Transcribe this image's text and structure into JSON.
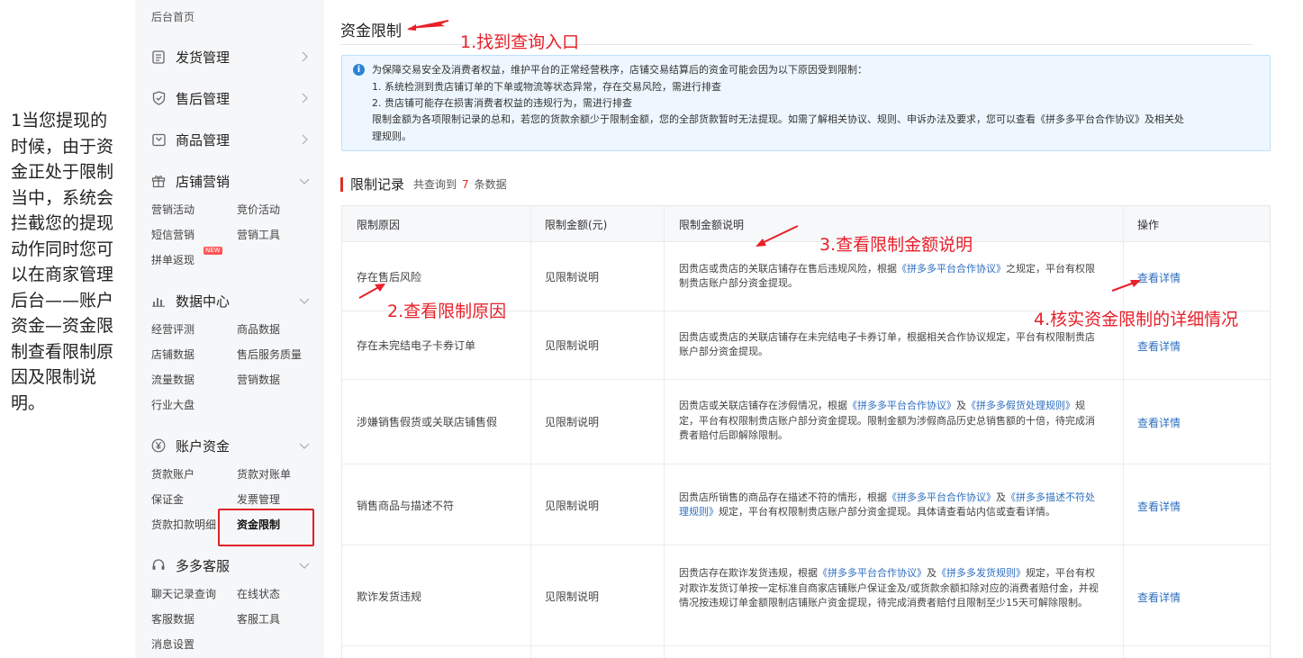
{
  "side_note": "1当您提现的时候，由于资金正处于限制当中，系统会拦截您的提现动作同时您可以在商家管理后台——账户资金—资金限制查看限制原因及限制说明。",
  "sidebar": {
    "home": "后台首页",
    "groups": [
      {
        "label": "发货管理",
        "icon": "document-icon"
      },
      {
        "label": "售后管理",
        "icon": "shield-icon"
      },
      {
        "label": "商品管理",
        "icon": "box-icon"
      },
      {
        "label": "店铺营销",
        "icon": "gift-icon",
        "items": [
          "营销活动",
          "竞价活动",
          "短信营销",
          "营销工具",
          "拼单返现"
        ],
        "new_badge": "NEW"
      },
      {
        "label": "数据中心",
        "icon": "bar-chart-icon",
        "items": [
          "经营评测",
          "商品数据",
          "店铺数据",
          "售后服务质量",
          "流量数据",
          "营销数据",
          "行业大盘"
        ]
      },
      {
        "label": "账户资金",
        "icon": "yen-icon",
        "items": [
          "货款账户",
          "货款对账单",
          "保证金",
          "发票管理",
          "货款扣款明细",
          "资金限制"
        ]
      },
      {
        "label": "多多客服",
        "icon": "headset-icon",
        "items": [
          "聊天记录查询",
          "在线状态",
          "客服数据",
          "客服工具",
          "消息设置"
        ]
      }
    ]
  },
  "main": {
    "title": "资金限制",
    "notice": {
      "line1": "为保障交易安全及消费者权益，维护平台的正常经营秩序，店铺交易结算后的资金可能会因为以下原因受到限制：",
      "line2": "1. 系统检测到贵店铺订单的下单或物流等状态异常，存在交易风险，需进行排查",
      "line3": "2. 贵店铺可能存在损害消费者权益的违规行为，需进行排查",
      "line4": "限制金额为各项限制记录的总和，若您的货款余额少于限制金额，您的全部货款暂时无法提现。如需了解相关协议、规则、申诉办法及要求，您可以查看《拼多多平台合作协议》及相关处",
      "line5": "理规则。"
    },
    "records": {
      "title": "限制记录",
      "count_prefix": "共查询到",
      "count": "7",
      "count_suffix": "条数据"
    },
    "table": {
      "headers": [
        "限制原因",
        "限制金额(元)",
        "限制金额说明",
        "操作"
      ],
      "rows": [
        {
          "reason": "存在售后风险",
          "amount": "见限制说明",
          "desc": [
            [
              "因贵店或贵店的关联店铺存在售后违规风险，根据",
              ""
            ],
            [
              "《拼多多平台合作协议》",
              "link"
            ],
            [
              "之规定，平台有权限制贵店账户部分资金提现。",
              ""
            ]
          ],
          "action": "查看详情"
        },
        {
          "reason": "存在未完结电子卡券订单",
          "amount": "见限制说明",
          "desc": [
            [
              "因贵店或贵店的关联店铺存在未完结电子卡券订单，根据相关合作协议规定，平台有权限制贵店账户部分资金提现。",
              ""
            ]
          ],
          "action": "查看详情"
        },
        {
          "reason": "涉嫌销售假货或关联店铺售假",
          "amount": "见限制说明",
          "desc": [
            [
              "因贵店或关联店铺存在涉假情况，根据",
              ""
            ],
            [
              "《拼多多平台合作协议》",
              "link"
            ],
            [
              "及",
              ""
            ],
            [
              "《拼多多假货处理规则》",
              "link"
            ],
            [
              "规定，平台有权限制贵店账户部分资金提现。限制金额为涉假商品历史总销售额的十倍，待完成消费者赔付后即解除限制。",
              ""
            ]
          ],
          "action": "查看详情"
        },
        {
          "reason": "销售商品与描述不符",
          "amount": "见限制说明",
          "desc": [
            [
              "因贵店所销售的商品存在描述不符的情形，根据",
              ""
            ],
            [
              "《拼多多平台合作协议》",
              "link"
            ],
            [
              "及",
              ""
            ],
            [
              "《拼多多描述不符处理规则》",
              "link"
            ],
            [
              "规定，平台有权限制贵店账户部分资金提现。具体请查看站内信或查看详情。",
              ""
            ]
          ],
          "action": "查看详情"
        },
        {
          "reason": "欺诈发货违规",
          "amount": "见限制说明",
          "desc": [
            [
              "因贵店存在欺诈发货违规，根据",
              ""
            ],
            [
              "《拼多多平台合作协议》",
              "link"
            ],
            [
              "及",
              ""
            ],
            [
              "《拼多多发货规则》",
              "link"
            ],
            [
              "规定，平台有权对欺诈发货订单按一定标准自商家店铺账户保证金及/或货款余额扣除对应的消费者赔付金，并视情况按违规订单金额限制店铺账户资金提现，待完成消费者赔付且限制至少15天可解除限制。",
              ""
            ]
          ],
          "action": "查看详情"
        }
      ]
    }
  },
  "annotations": {
    "step1": "1.找到查询入口",
    "step2": "2.查看限制原因",
    "step3": "3.查看限制金额说明",
    "step4": "4.核实资金限制的详细情况"
  },
  "colors": {
    "annotation": "#e8202a",
    "link": "#2e6fbf",
    "accent": "#e02e24",
    "notice_bg": "#eef7ff"
  }
}
